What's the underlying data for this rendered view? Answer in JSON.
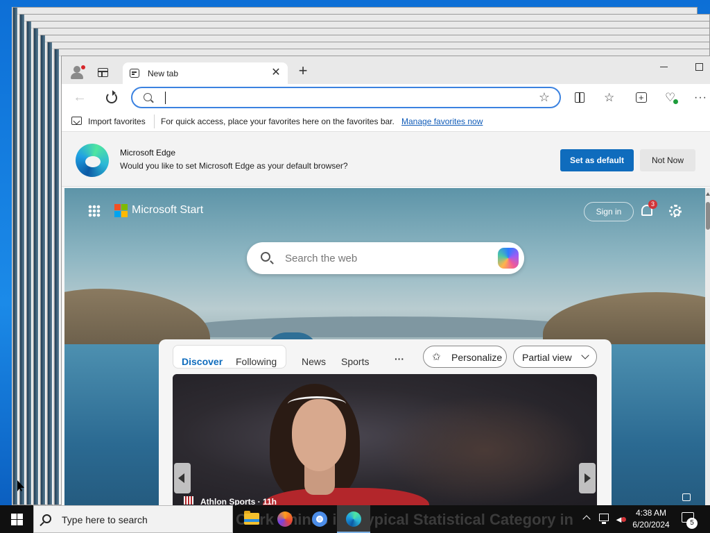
{
  "browser": {
    "tab_title": "New tab",
    "tab_close": "✕",
    "new_tab": "+",
    "favorites_bar": {
      "import_label": "Import favorites",
      "message": "For quick access, place your favorites here on the favorites bar.",
      "manage_link": "Manage favorites now"
    },
    "infobar": {
      "title": "Microsoft Edge",
      "message": "Would you like to set Microsoft Edge as your default browser?",
      "primary_button": "Set as default",
      "secondary_button": "Not Now"
    }
  },
  "start_page": {
    "brand": "Microsoft Start",
    "sign_in": "Sign in",
    "notification_count": "3",
    "search_placeholder": "Search the web",
    "feed_tabs": [
      "Discover",
      "Following",
      "News",
      "Sports"
    ],
    "more_label": "···",
    "personalize_label": "Personalize",
    "view_label": "Partial view",
    "card_source": "Athlon Sports · 11h"
  },
  "taskbar": {
    "search_placeholder": "Type here to search",
    "news_ticker": "Clark Shines in Atypical Statistical Category in",
    "time": "4:38 AM",
    "date": "6/20/2024",
    "notification_count": "5"
  },
  "colors": {
    "accent": "#0f6cbd",
    "address_focus": "#3b82e0",
    "taskbar": "#101010"
  }
}
